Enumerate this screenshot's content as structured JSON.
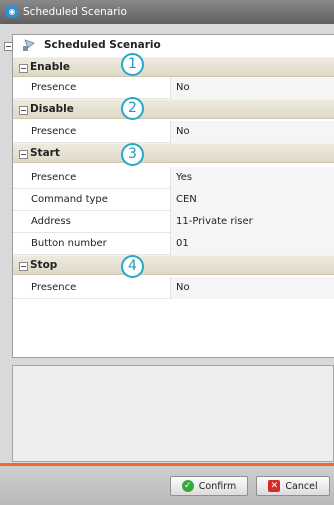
{
  "window": {
    "title": "Scheduled Scenario",
    "icon": "app-icon"
  },
  "tree": {
    "root_label": "Scheduled Scenario",
    "sections": [
      {
        "label": "Enable",
        "badge": "1",
        "rows": [
          {
            "key": "Presence",
            "value": "No"
          }
        ]
      },
      {
        "label": "Disable",
        "badge": "2",
        "rows": [
          {
            "key": "Presence",
            "value": "No"
          }
        ]
      },
      {
        "label": "Start",
        "badge": "3",
        "rows": [
          {
            "key": "Presence",
            "value": "Yes"
          },
          {
            "key": "Command type",
            "value": "CEN"
          },
          {
            "key": "Address",
            "value": "11-Private riser"
          },
          {
            "key": "Button number",
            "value": "01"
          }
        ]
      },
      {
        "label": "Stop",
        "badge": "4",
        "rows": [
          {
            "key": "Presence",
            "value": "No"
          }
        ]
      }
    ]
  },
  "footer": {
    "confirm_label": "Confirm",
    "cancel_label": "Cancel"
  },
  "colors": {
    "badge_accent": "#25a8c7",
    "footer_accent": "#f26b2b"
  }
}
